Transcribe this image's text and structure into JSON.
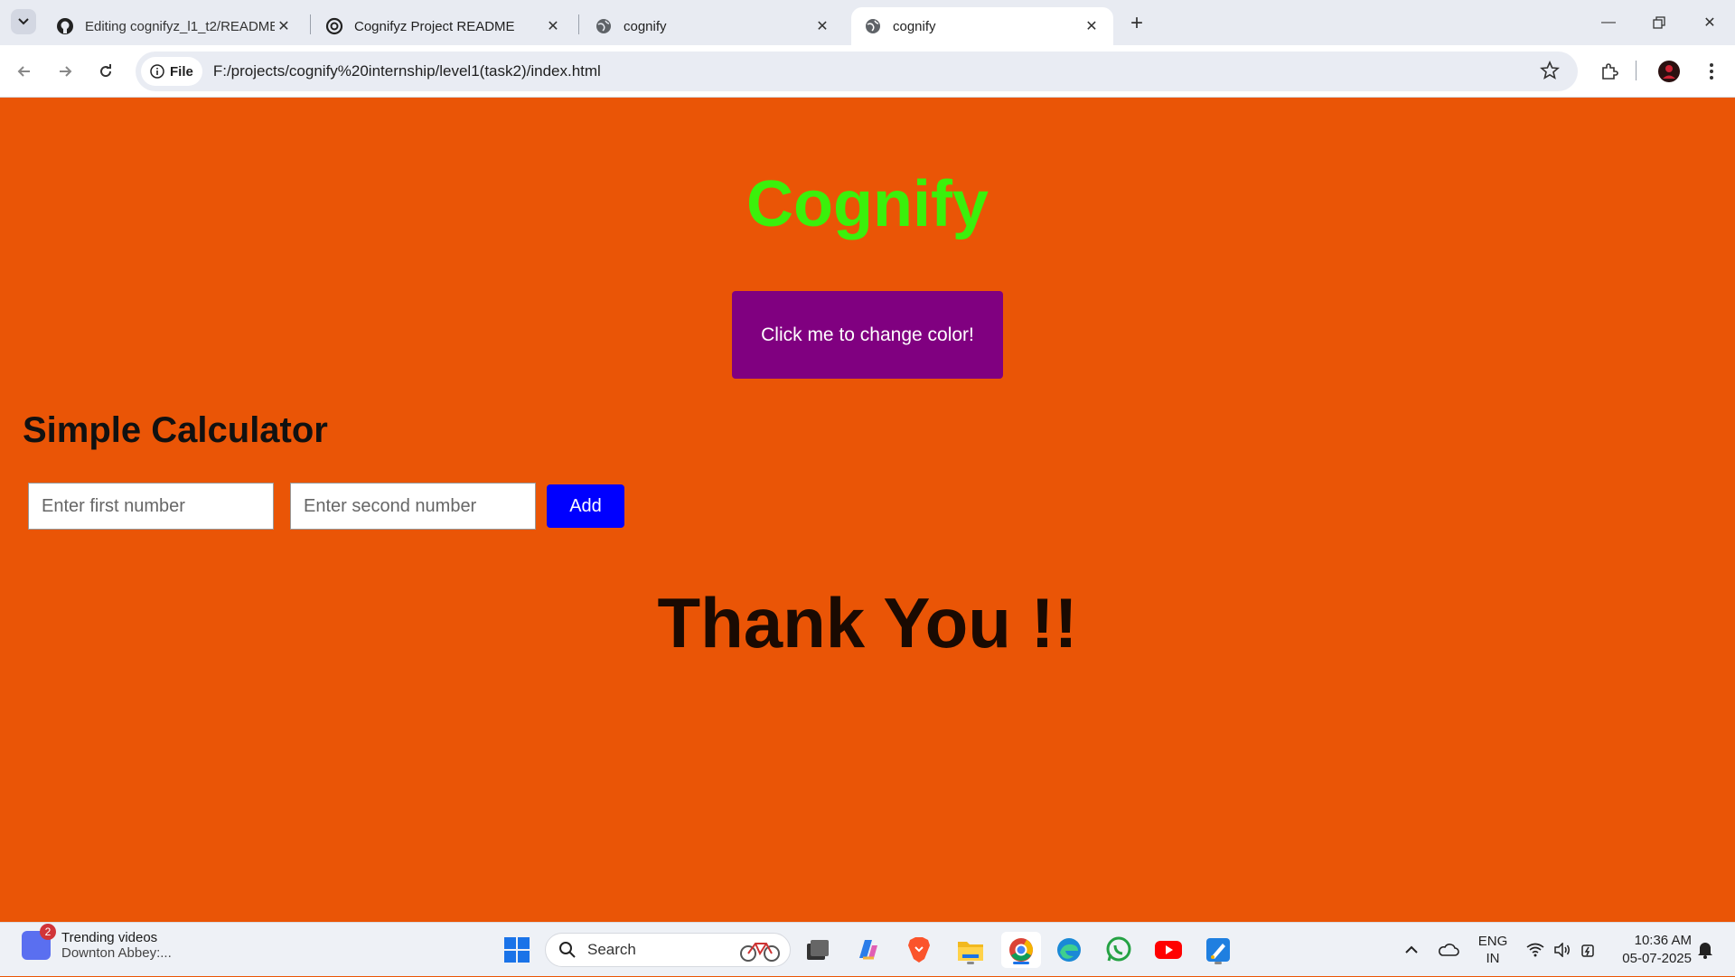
{
  "browser": {
    "tabs": [
      {
        "label": "Editing cognifyz_l1_t2/README",
        "icon": "github-icon",
        "active": false
      },
      {
        "label": "Cognifyz Project README",
        "icon": "openai-icon",
        "active": false
      },
      {
        "label": "cognify",
        "icon": "globe-icon",
        "active": false
      },
      {
        "label": "cognify",
        "icon": "globe-icon",
        "active": true
      }
    ],
    "chip_label": "File",
    "url": "F:/projects/cognify%20internship/level1(task2)/index.html"
  },
  "page": {
    "title": "Cognify",
    "color_button_label": "Click me to change color!",
    "calculator_title": "Simple Calculator",
    "first_number_placeholder": "Enter first number",
    "second_number_placeholder": "Enter second number",
    "add_label": "Add",
    "thanks": "Thank You !!",
    "colors": {
      "background": "#ea5506",
      "title": "#3bf00b",
      "color_button": "#800080",
      "add_button": "#0000ff"
    }
  },
  "taskbar": {
    "widget_badge": "2",
    "widget_title": "Trending videos",
    "widget_subtitle": "Downton Abbey:...",
    "search_label": "Search",
    "lang_line1": "ENG",
    "lang_line2": "IN",
    "time": "10:36 AM",
    "date": "05-07-2025"
  }
}
